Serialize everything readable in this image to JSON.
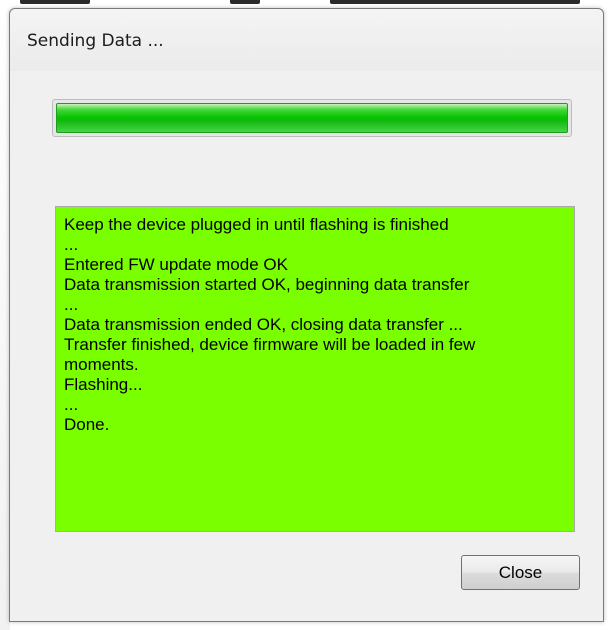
{
  "window": {
    "title": "Sending Data ..."
  },
  "progress": {
    "value_percent": 100,
    "color": "#06c300"
  },
  "log": {
    "background": "#7aff00",
    "lines": [
      "Keep the device plugged in until flashing is finished",
      "...",
      "Entered FW update mode OK",
      "Data transmission started OK, beginning data transfer",
      "...",
      "Data transmission ended OK, closing data transfer ...",
      "Transfer finished, device firmware will be loaded in few",
      "moments.",
      "Flashing...",
      "...",
      "Done."
    ]
  },
  "buttons": {
    "close_label": "Close"
  }
}
